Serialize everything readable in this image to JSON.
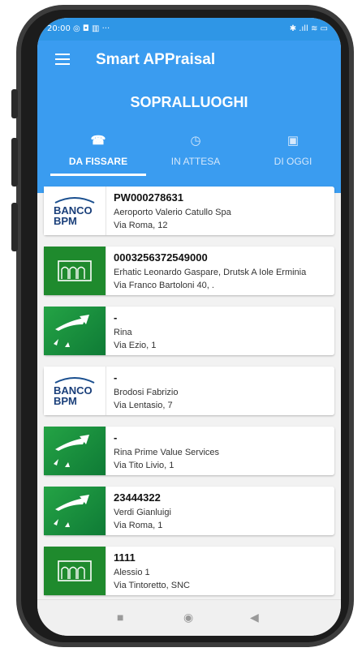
{
  "status_bar": {
    "left": "20:00 ◎ ◘ ▥ ···",
    "right": "✱ .ıll ≋ ▭"
  },
  "app": {
    "title": "Smart APPraisal",
    "section_title": "SOPRALLUOGHI"
  },
  "tabs": [
    {
      "label": "DA FISSARE",
      "icon": "phone-icon",
      "glyph": "☎"
    },
    {
      "label": "IN ATTESA",
      "icon": "clock-icon",
      "glyph": "◷"
    },
    {
      "label": "DI OGGI",
      "icon": "calendar-icon",
      "glyph": "▣"
    }
  ],
  "cards": [
    {
      "logo": "banco-bpm",
      "logo_text": [
        "BANCO",
        "BPM"
      ],
      "code": "PW000278631",
      "name": "Aeroporto Valerio Catullo Spa",
      "address": "Via Roma, 12"
    },
    {
      "logo": "green-building",
      "code": "0003256372549000",
      "name": "Erhatic Leonardo Gaspare, Drutsk A Iole Erminia",
      "address": "Via Franco Bartoloni 40, ."
    },
    {
      "logo": "bnp-stars",
      "code": "-",
      "name": "Rina",
      "address": "Via Ezio, 1"
    },
    {
      "logo": "banco-bpm",
      "logo_text": [
        "BANCO",
        "BPM"
      ],
      "code": "-",
      "name": "Brodosi Fabrizio",
      "address": "Via Lentasio, 7"
    },
    {
      "logo": "bnp-stars",
      "code": "-",
      "name": "Rina Prime Value Services",
      "address": "Via Tito Livio, 1"
    },
    {
      "logo": "bnp-stars",
      "code": "23444322",
      "name": "Verdi Gianluigi",
      "address": "Via Roma, 1"
    },
    {
      "logo": "green-building",
      "code": "1111",
      "name": "Alessio 1",
      "address": "Via Tintoretto, SNC"
    }
  ],
  "nav": {
    "recent": "■",
    "home": "◉",
    "back": "◀"
  },
  "colors": {
    "primary": "#3a9cf0",
    "green_logo": "#1f8a2d",
    "bnp_green": "#24a345"
  }
}
